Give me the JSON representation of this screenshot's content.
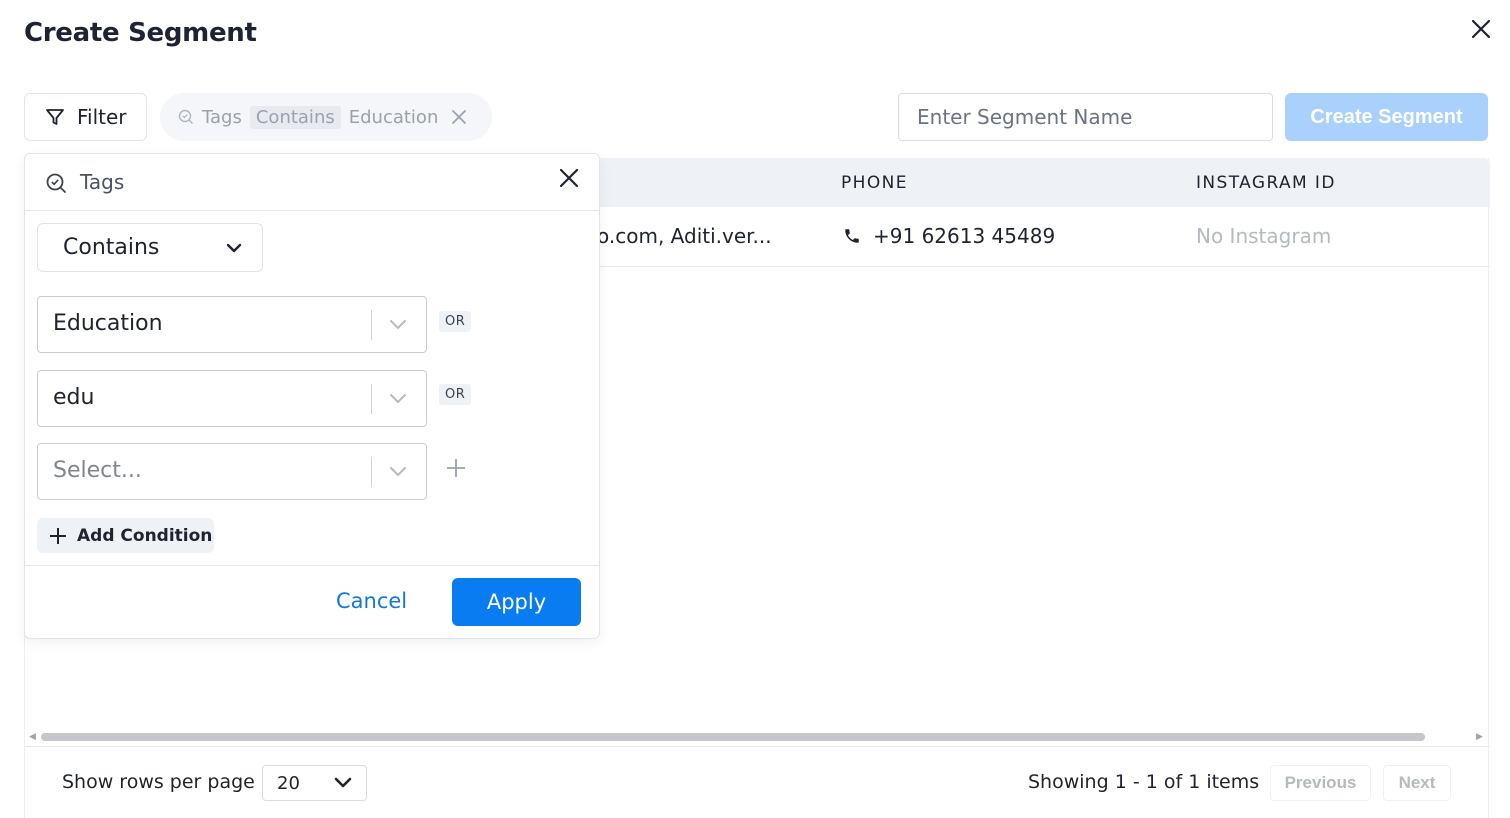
{
  "page": {
    "title": "Create Segment"
  },
  "toolbar": {
    "filter_label": "Filter",
    "chip": {
      "field": "Tags",
      "operator": "Contains",
      "value": "Education"
    },
    "segment_name_placeholder": "Enter Segment Name",
    "create_label": "Create Segment"
  },
  "table": {
    "headers": {
      "phone": "PHONE",
      "instagram": "INSTAGRAM ID"
    },
    "rows": [
      {
        "email": "o.com, Aditi.ver...",
        "phone": "+91 62613 45489",
        "instagram": "No Instagram"
      }
    ]
  },
  "filter_popover": {
    "field_label": "Tags",
    "operator": "Contains",
    "values": [
      "Education",
      "edu"
    ],
    "select_placeholder": "Select...",
    "or_label": "OR",
    "add_condition_label": "Add Condition",
    "cancel_label": "Cancel",
    "apply_label": "Apply"
  },
  "pagination": {
    "rows_label": "Show rows per page",
    "rows_per_page": "20",
    "showing_text": "Showing 1 - 1 of 1 items",
    "previous_label": "Previous",
    "next_label": "Next"
  },
  "colors": {
    "primary": "#0a7cf2",
    "primary_disabled": "#a9d1fb",
    "header_bg": "#eef1f5"
  }
}
